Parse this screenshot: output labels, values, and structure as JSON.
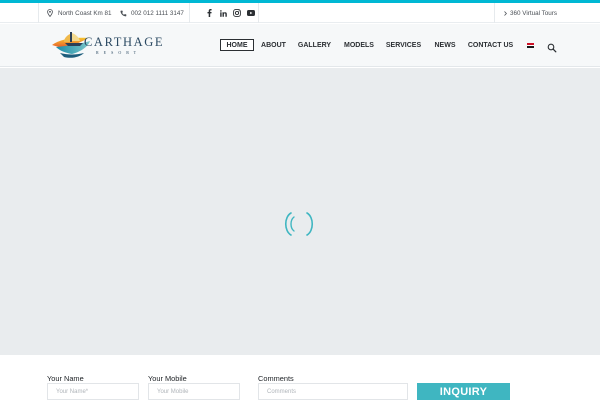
{
  "colors": {
    "accent": "#00b8d4",
    "button": "#3fb6c1",
    "hero_bg": "#e9ecee"
  },
  "topbar": {
    "location_icon": "map-pin-icon",
    "location": "North Coast Km 81",
    "phone_icon": "phone-icon",
    "phone": "002 012 1111 3147",
    "social": [
      "facebook-icon",
      "linkedin-icon",
      "instagram-icon",
      "youtube-icon"
    ],
    "virtual_tours": "360 Virtual Tours"
  },
  "header": {
    "logo_title": "CARTHAGE",
    "logo_subtitle": "RESORT",
    "nav": [
      "HOME",
      "ABOUT",
      "GALLERY",
      "MODELS",
      "SERVICES",
      "NEWS",
      "CONTACT US"
    ],
    "active_nav": "HOME",
    "language_icon": "egypt-flag-icon",
    "search_icon": "search-icon"
  },
  "hero": {
    "loader_icon": "loading-spinner-icon"
  },
  "form": {
    "name_label": "Your Name",
    "name_placeholder": "Your Name*",
    "mobile_label": "Your Mobile",
    "mobile_placeholder": "Your Mobile",
    "comments_label": "Comments",
    "comments_placeholder": "Comments",
    "submit": "INQUIRY"
  }
}
